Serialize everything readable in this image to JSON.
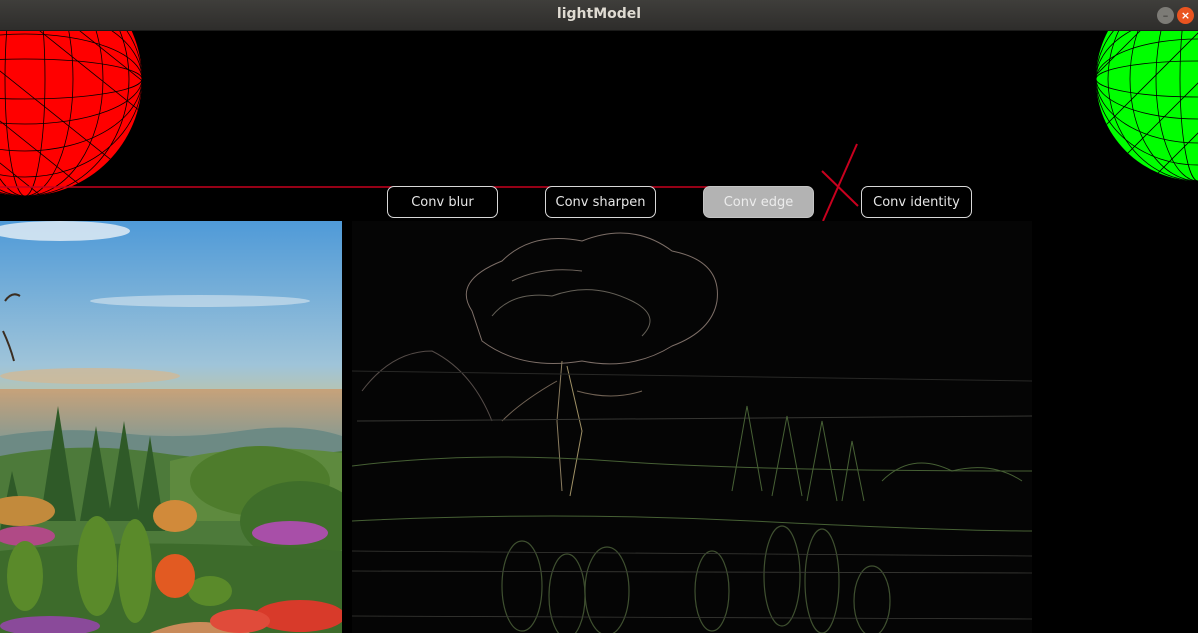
{
  "window": {
    "title": "lightModel",
    "minimize_icon": "minimize-icon",
    "close_icon": "close-icon"
  },
  "buttons": [
    {
      "label": "Conv blur",
      "active": false
    },
    {
      "label": "Conv sharpen",
      "active": false
    },
    {
      "label": "Conv edge",
      "active": true
    },
    {
      "label": "Conv identity",
      "active": false
    }
  ],
  "colors": {
    "left_sphere": "#ff0000",
    "right_sphere": "#00ff00",
    "guide_line": "#c8001e",
    "button_active": "#b3b3b3",
    "background": "#000000"
  }
}
